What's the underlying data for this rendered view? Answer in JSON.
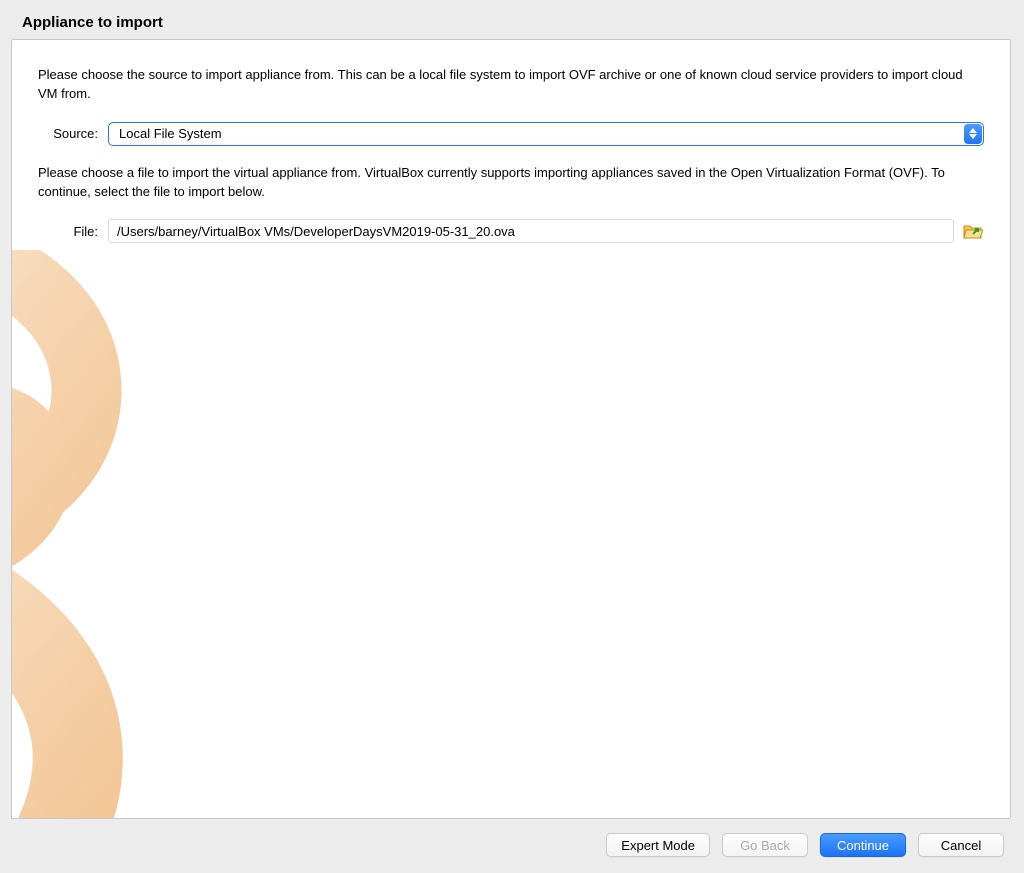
{
  "title": "Appliance to import",
  "intro_text": "Please choose the source to import appliance from. This can be a local file system to import OVF archive or one of known cloud service providers to import cloud VM from.",
  "source_label": "Source:",
  "source_value": "Local File System",
  "file_intro_text": "Please choose a file to import the virtual appliance from. VirtualBox currently supports importing appliances saved in the Open Virtualization Format (OVF). To continue, select the file to import below.",
  "file_label": "File:",
  "file_value": "/Users/barney/VirtualBox VMs/DeveloperDaysVM2019-05-31_20.ova",
  "buttons": {
    "expert": "Expert Mode",
    "back": "Go Back",
    "continue": "Continue",
    "cancel": "Cancel"
  }
}
